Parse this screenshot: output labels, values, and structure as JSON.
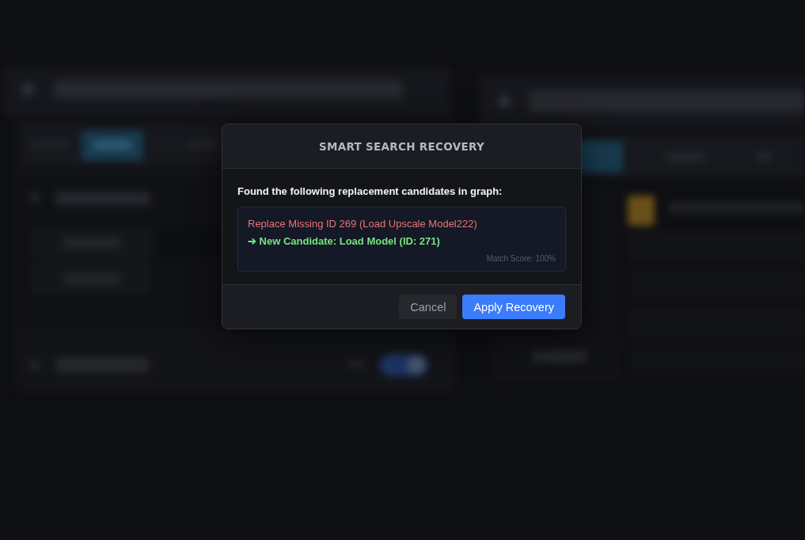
{
  "backdrop": {
    "blurred": true
  },
  "dialog": {
    "title": "SMART SEARCH RECOVERY",
    "intro": "Found the following replacement candidates in graph:",
    "candidates": [
      {
        "missing": "Replace Missing ID 269 (Load Upscale Model222)",
        "replacement": "➔ New Candidate: Load Model (ID: 271)",
        "score": "Match Score: 100%"
      }
    ],
    "buttons": [
      {
        "label": "Cancel",
        "kind": "secondary"
      },
      {
        "label": "Apply Recovery",
        "kind": "primary"
      }
    ]
  }
}
